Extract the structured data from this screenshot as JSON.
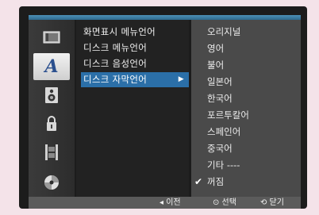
{
  "menu": {
    "items": [
      {
        "label": "화면표시 메뉴언어"
      },
      {
        "label": "디스크 메뉴언어"
      },
      {
        "label": "디스크 음성언어"
      },
      {
        "label": "디스크 자막언어",
        "arrow": "▶"
      }
    ]
  },
  "options": {
    "items": [
      {
        "label": "오리지널"
      },
      {
        "label": "영어"
      },
      {
        "label": "불어"
      },
      {
        "label": "일본어"
      },
      {
        "label": "한국어"
      },
      {
        "label": "포르투칼어"
      },
      {
        "label": "스페인어"
      },
      {
        "label": "중국어"
      },
      {
        "label": "기타 ----"
      },
      {
        "label": "꺼짐",
        "check": "✔"
      }
    ]
  },
  "sidebar": {
    "icons": [
      "display-icon",
      "language-icon",
      "audio-speaker-icon",
      "lock-icon",
      "film-icon",
      "disc-icon"
    ],
    "language_glyph": "A"
  },
  "footer": {
    "prev": "◂ 이전",
    "select": "⊙ 선택",
    "close": "⟲ 닫기"
  },
  "colors": {
    "accent": "#2b6fa8",
    "topbar": "#3f80a8",
    "background": "#f4e3e9"
  }
}
